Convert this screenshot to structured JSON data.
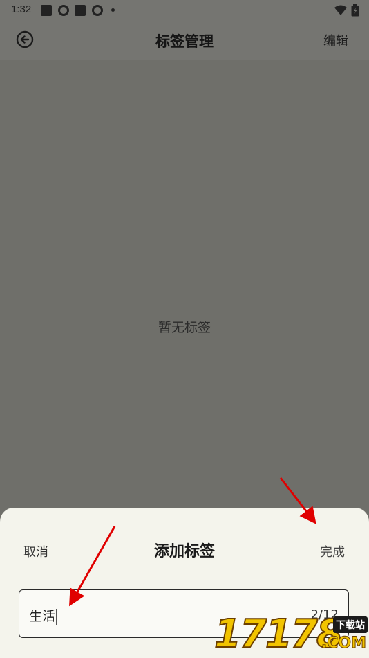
{
  "status_bar": {
    "time": "1:32",
    "icons": [
      "notification-square-icon",
      "aperture-icon",
      "notification-square-icon",
      "aperture-icon",
      "more-dot-icon",
      "wifi-icon",
      "battery-icon"
    ]
  },
  "app_bar": {
    "title": "标签管理",
    "edit_label": "编辑",
    "back_icon": "back-arrow-circle-icon"
  },
  "main": {
    "empty_text": "暂无标签"
  },
  "add_tag_sheet": {
    "title": "添加标签",
    "cancel_label": "取消",
    "done_label": "完成",
    "input_value": "生活",
    "counter": "2/12"
  },
  "annotations": {
    "arrow_color": "#e00000",
    "arrows": [
      "pointing-to-done-button",
      "pointing-to-input-text"
    ]
  },
  "watermark": {
    "digits": "17178",
    "tag": "下载站",
    "suffix": ".COM"
  },
  "colors": {
    "overlay": "#6f6f6a",
    "sheet": "#f4f4ec"
  }
}
